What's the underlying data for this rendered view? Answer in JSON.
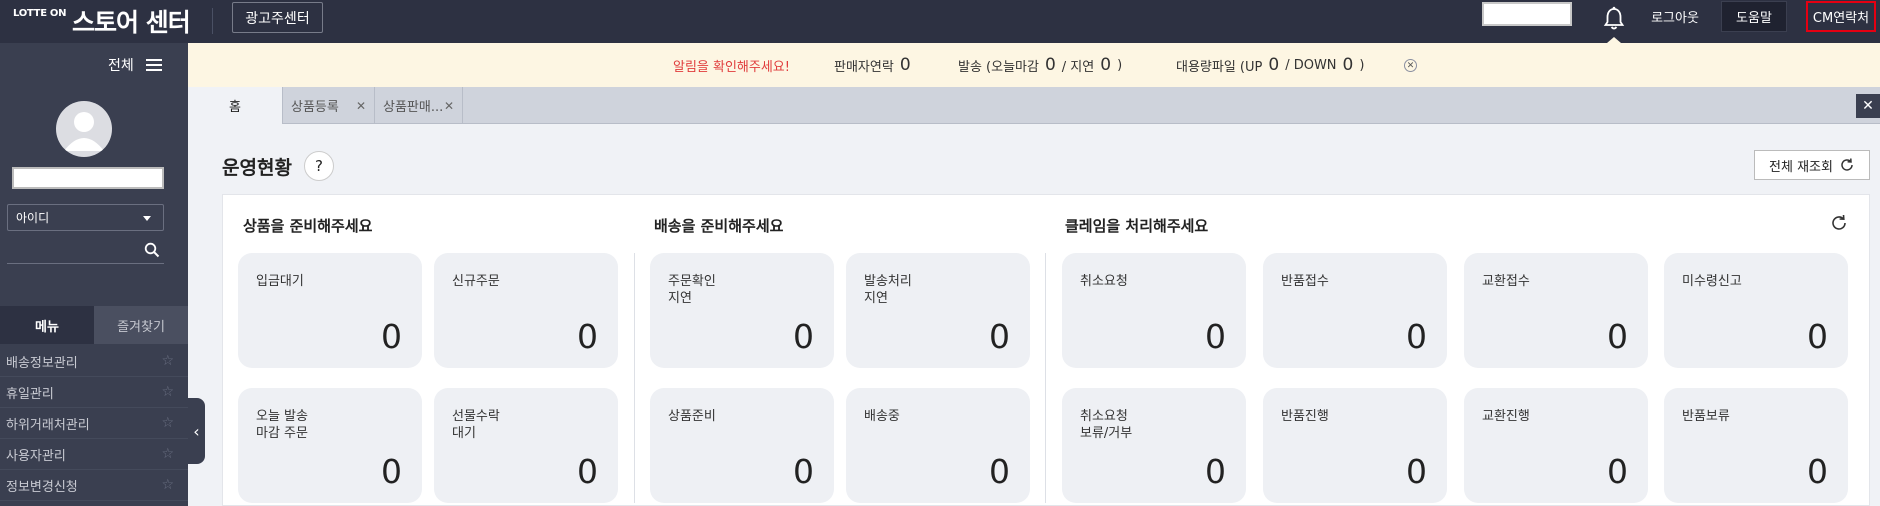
{
  "header": {
    "logo_small": "LOTTE ON",
    "logo_big": "스토어 센터",
    "ad_center_label": "광고주센터",
    "logout_label": "로그아웃",
    "help_label": "도움말",
    "cm_contact_label": "CM연락처"
  },
  "sidebar": {
    "all_menu_label": "전체",
    "id_select_value": "아이디",
    "tabs": [
      "메뉴",
      "즐겨찾기"
    ],
    "menu_items": [
      "배송정보관리",
      "휴일관리",
      "하위거래처관리",
      "사용자관리",
      "정보변경신청"
    ]
  },
  "notice": {
    "alert": "알림을 확인해주세요!",
    "seller_contact_label": "판매자연락",
    "seller_contact_count": "0",
    "shipping_label": "발송 (오늘마감",
    "shipping_today": "0",
    "shipping_delay_label": "/ 지연",
    "shipping_delay": "0",
    "shipping_close": ")",
    "bulk_file_label": "대용량파일 (UP",
    "bulk_up": "0",
    "bulk_down_label": "/ DOWN",
    "bulk_down": "0",
    "bulk_close": ")"
  },
  "tabs": [
    {
      "label": "홈"
    },
    {
      "label": "상품등록"
    },
    {
      "label": "상품판매..."
    }
  ],
  "main": {
    "title": "운영현황",
    "help": "?",
    "refresh_all_label": "전체 재조회",
    "groups": [
      {
        "title": "상품을 준비해주세요",
        "cards": [
          {
            "label": "입금대기",
            "count": "0"
          },
          {
            "label": "신규주문",
            "count": "0"
          },
          {
            "label": "오늘 발송\n마감 주문",
            "count": "0"
          },
          {
            "label": "선물수락\n대기",
            "count": "0"
          }
        ]
      },
      {
        "title": "배송을 준비해주세요",
        "cards": [
          {
            "label": "주문확인\n지연",
            "count": "0"
          },
          {
            "label": "발송처리\n지연",
            "count": "0"
          },
          {
            "label": "상품준비",
            "count": "0"
          },
          {
            "label": "배송중",
            "count": "0"
          }
        ]
      },
      {
        "title": "클레임을 처리해주세요",
        "cards": [
          {
            "label": "취소요청",
            "count": "0"
          },
          {
            "label": "반품접수",
            "count": "0"
          },
          {
            "label": "교환접수",
            "count": "0"
          },
          {
            "label": "미수령신고",
            "count": "0"
          },
          {
            "label": "취소요청\n보류/거부",
            "count": "0"
          },
          {
            "label": "반품진행",
            "count": "0"
          },
          {
            "label": "교환진행",
            "count": "0"
          },
          {
            "label": "반품보류",
            "count": "0"
          }
        ]
      }
    ]
  },
  "colors": {
    "topbar": "#2d3142",
    "sidebar": "#3a3f50",
    "notice_bg": "#fdf6e3",
    "alert_red": "#e03c3c",
    "cm_border": "#e60012",
    "card_bg": "#eef0f4"
  },
  "icons": [
    "bell-icon",
    "hamburger-icon",
    "user-avatar-icon",
    "search-icon",
    "chevron-down-icon",
    "star-icon",
    "close-icon",
    "refresh-icon",
    "chevron-left-icon",
    "help-icon"
  ]
}
